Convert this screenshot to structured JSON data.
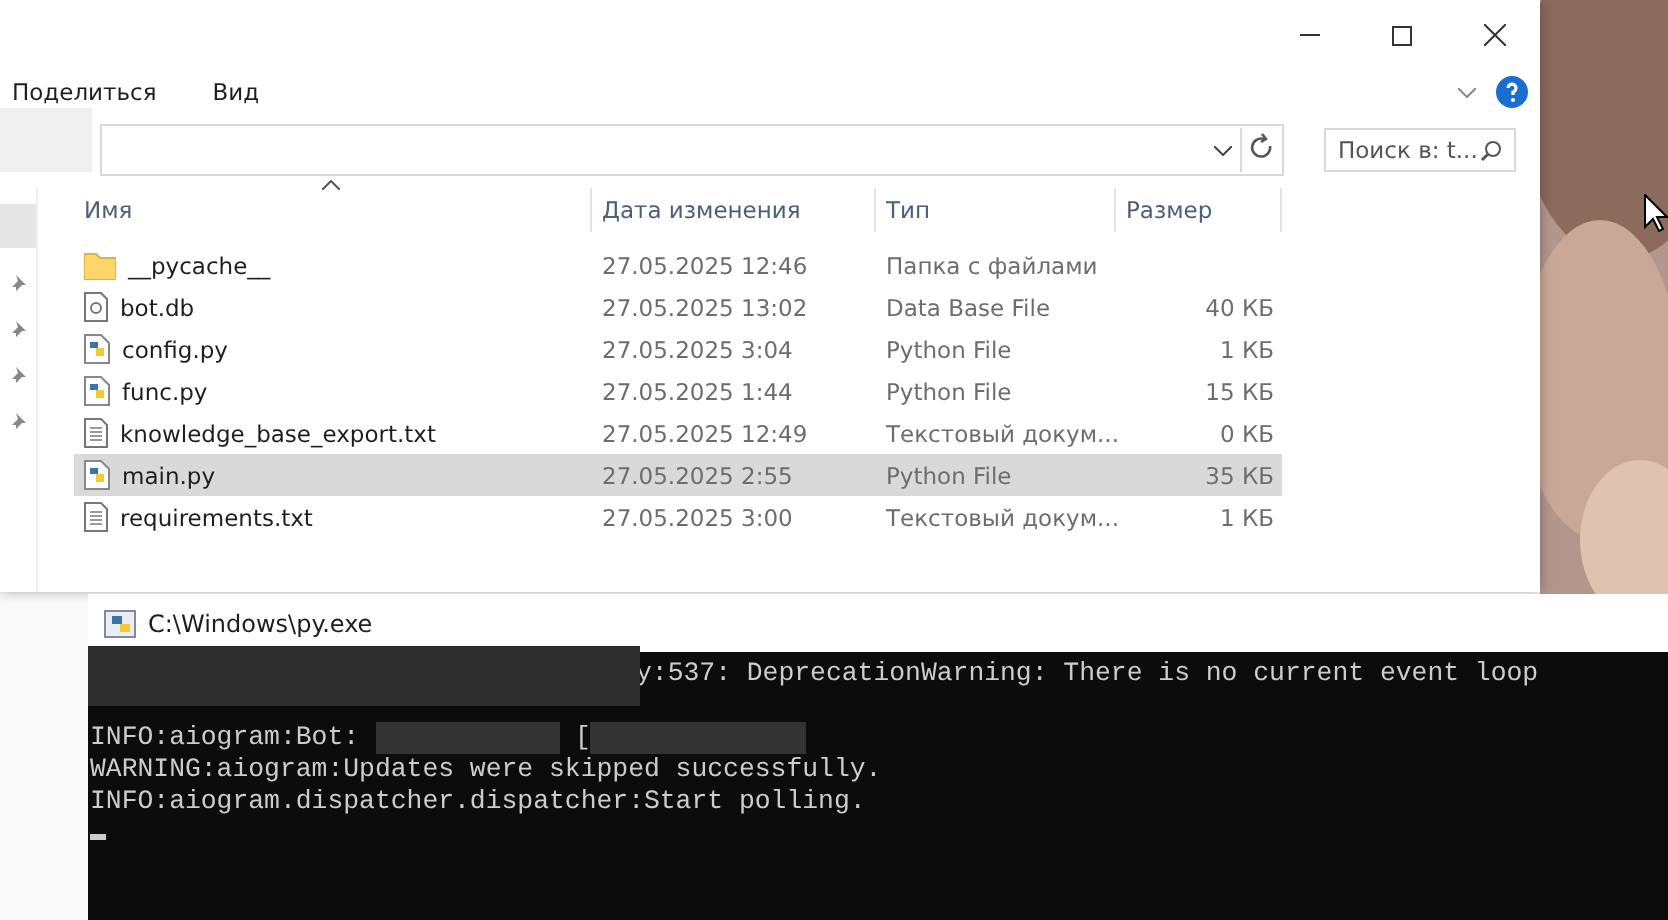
{
  "explorer": {
    "ribbon_tabs": [
      "Поделиться",
      "Вид"
    ],
    "search": {
      "placeholder": "Поиск в: t..."
    },
    "columns": [
      "Имя",
      "Дата изменения",
      "Тип",
      "Размер"
    ],
    "rows": [
      {
        "name": "__pycache__",
        "date": "27.05.2025 12:46",
        "type": "Папка с файлами",
        "size": "",
        "kind": "folder",
        "selected": false
      },
      {
        "name": "bot.db",
        "date": "27.05.2025 13:02",
        "type": "Data Base File",
        "size": "40 КБ",
        "kind": "database",
        "selected": false
      },
      {
        "name": "config.py",
        "date": "27.05.2025 3:04",
        "type": "Python File",
        "size": "1 КБ",
        "kind": "python",
        "selected": false
      },
      {
        "name": "func.py",
        "date": "27.05.2025 1:44",
        "type": "Python File",
        "size": "15 КБ",
        "kind": "python",
        "selected": false
      },
      {
        "name": "knowledge_base_export.txt",
        "date": "27.05.2025 12:49",
        "type": "Текстовый докум...",
        "size": "0 КБ",
        "kind": "text",
        "selected": false
      },
      {
        "name": "main.py",
        "date": "27.05.2025 2:55",
        "type": "Python File",
        "size": "35 КБ",
        "kind": "python",
        "selected": true
      },
      {
        "name": "requirements.txt",
        "date": "27.05.2025 3:00",
        "type": "Текстовый докум...",
        "size": "1 КБ",
        "kind": "text",
        "selected": false
      }
    ]
  },
  "console": {
    "title": "C:\\Windows\\py.exe",
    "lines": [
      {
        "kind": "after_redaction",
        "text": "y:537: DeprecationWarning: There is no current event loop"
      },
      {
        "kind": "hidden"
      },
      {
        "kind": "redacted_pair",
        "text": "INFO:aiogram:Bot:",
        "middle": "["
      },
      {
        "kind": "plain",
        "text": "WARNING:aiogram:Updates were skipped successfully."
      },
      {
        "kind": "plain",
        "text": "INFO:aiogram.dispatcher.dispatcher:Start polling."
      }
    ]
  }
}
